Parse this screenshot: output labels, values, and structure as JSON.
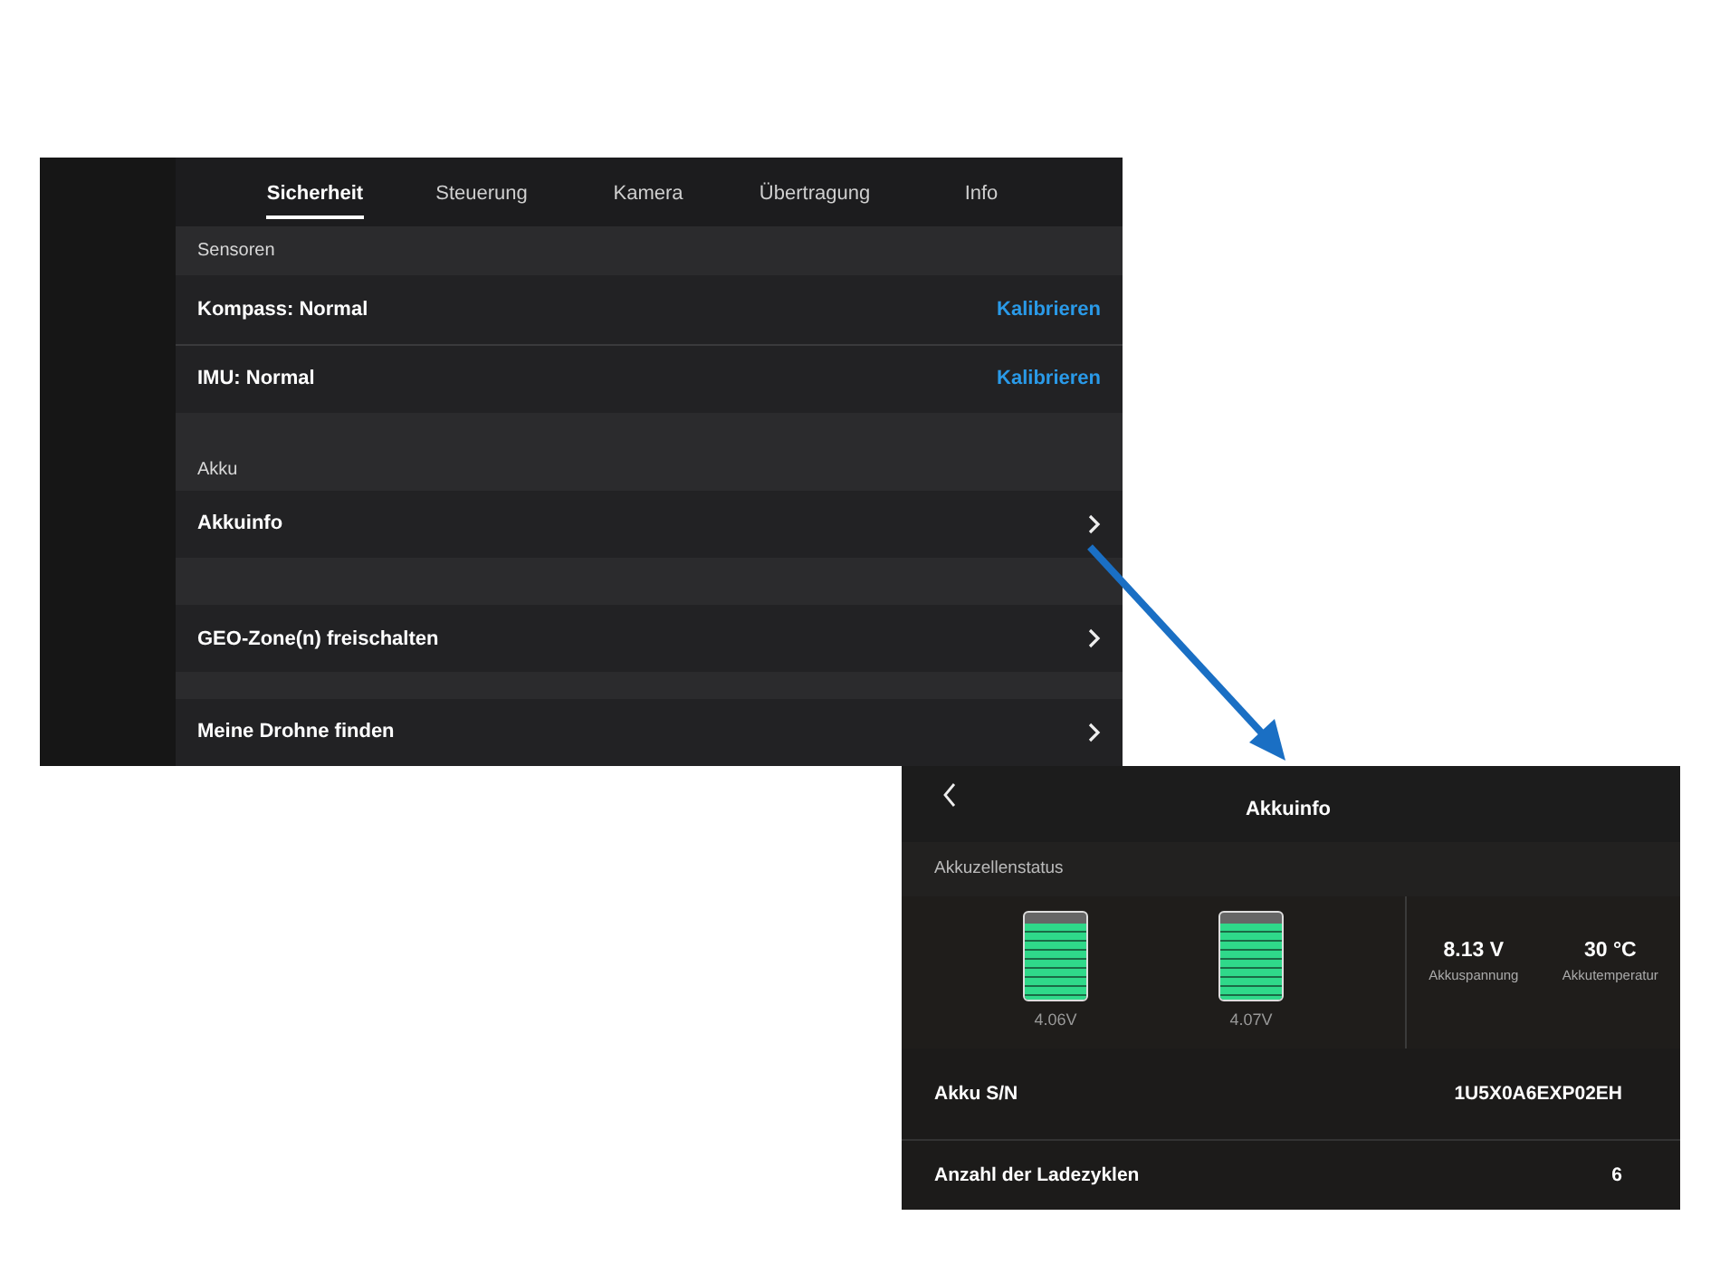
{
  "settings_screen": {
    "tabs": [
      {
        "label": "Sicherheit",
        "selected": true
      },
      {
        "label": "Steuerung",
        "selected": false
      },
      {
        "label": "Kamera",
        "selected": false
      },
      {
        "label": "Übertragung",
        "selected": false
      },
      {
        "label": "Info",
        "selected": false
      }
    ],
    "sections": [
      {
        "title": "Sensoren",
        "rows": [
          {
            "label": "Kompass: Normal",
            "kind": "action",
            "action": "Kalibrieren"
          },
          {
            "label": "IMU: Normal",
            "kind": "action",
            "action": "Kalibrieren"
          }
        ]
      },
      {
        "title": "Akku",
        "rows": [
          {
            "label": "Akkuinfo",
            "kind": "link"
          }
        ]
      },
      {
        "rows": [
          {
            "label": "GEO-Zone(n) freischalten",
            "kind": "link"
          }
        ]
      },
      {
        "rows": [
          {
            "label": "Meine Drohne finden",
            "kind": "link"
          }
        ]
      }
    ]
  },
  "battery_screen": {
    "title": "Akkuinfo",
    "section": "Akkuzellenstatus",
    "cells": [
      {
        "level": 0.86,
        "reading": "4.06V"
      },
      {
        "level": 0.86,
        "reading": "4.07V"
      }
    ],
    "stats": [
      {
        "value": "8.13 V",
        "label": "Akkuspannung"
      },
      {
        "value": "30 °C",
        "label": "Akkutemperatur"
      }
    ],
    "rows": [
      {
        "label": "Akku S/N",
        "value": "1U5X0A6EXP02EH"
      },
      {
        "label": "Anzahl der Ladezyklen",
        "value": "6"
      }
    ]
  }
}
